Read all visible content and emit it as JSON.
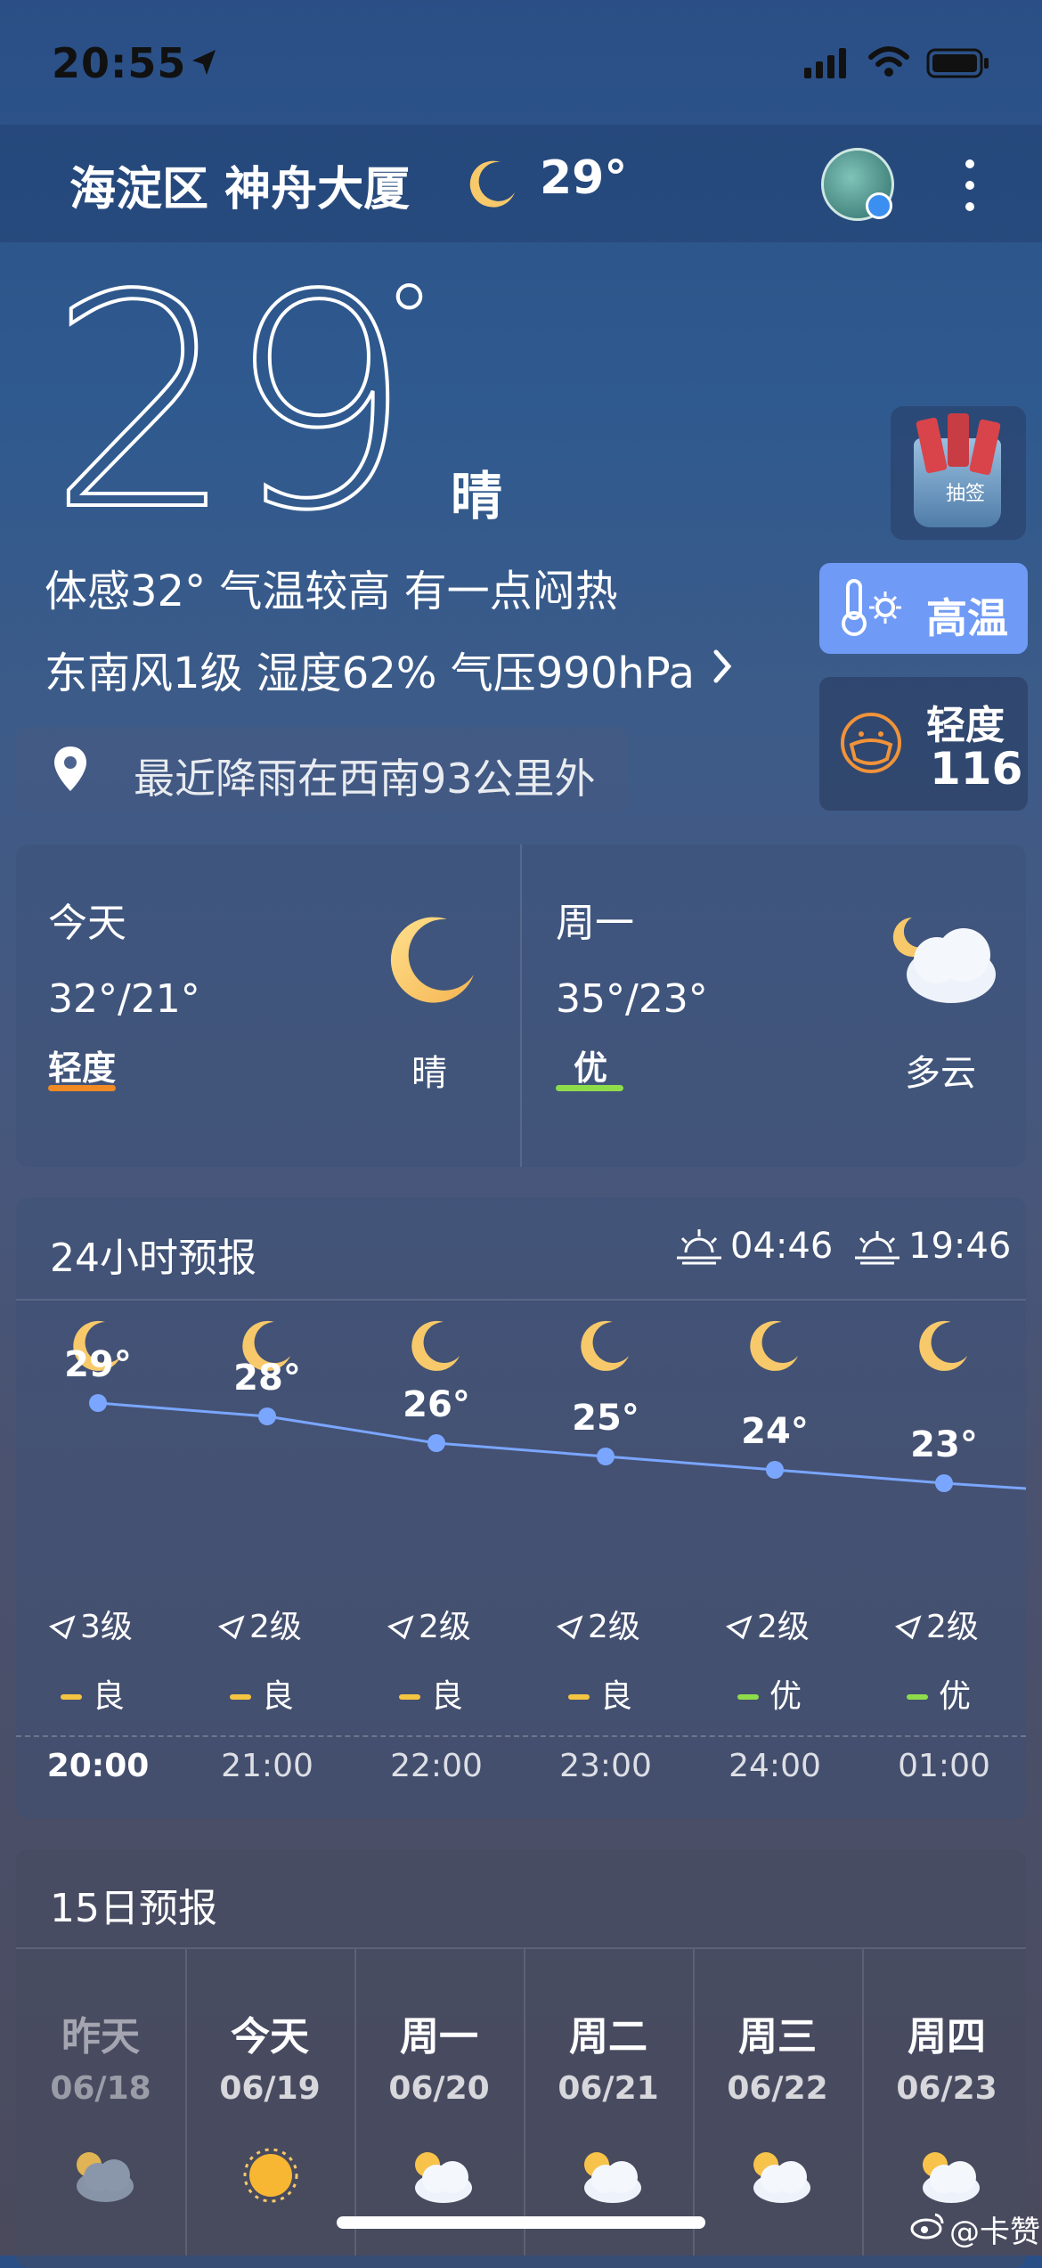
{
  "status_bar": {
    "time": "20:55"
  },
  "header": {
    "location": "海淀区 神舟大厦",
    "temp": "29°"
  },
  "current": {
    "temp": "29",
    "degree": "°",
    "condition": "晴",
    "feels_like": "体感32° 气温较高 有一点闷热",
    "details": "东南风1级 湿度62% 气压990hPa",
    "rain_notice": "最近降雨在西南93公里外"
  },
  "side": {
    "lottery_label": "抽签",
    "alert_label": "高温",
    "aqi_label": "轻度",
    "aqi_value": "116"
  },
  "daily_summary": [
    {
      "day": "今天",
      "range": "32°/21°",
      "aqi": "轻度",
      "aqi_color": "#f08a24",
      "cond": "晴"
    },
    {
      "day": "周一",
      "range": "35°/23°",
      "aqi": "优",
      "aqi_color": "#8fdc4a",
      "cond": "多云"
    }
  ],
  "hourly": {
    "title": "24小时预报",
    "sunrise": "04:46",
    "sunset": "19:46",
    "items": [
      {
        "temp": "29°",
        "wind": "3级",
        "aqi": "良",
        "aqi_color": "#f5c542",
        "time": "20:00"
      },
      {
        "temp": "28°",
        "wind": "2级",
        "aqi": "良",
        "aqi_color": "#f5c542",
        "time": "21:00"
      },
      {
        "temp": "26°",
        "wind": "2级",
        "aqi": "良",
        "aqi_color": "#f5c542",
        "time": "22:00"
      },
      {
        "temp": "25°",
        "wind": "2级",
        "aqi": "良",
        "aqi_color": "#f5c542",
        "time": "23:00"
      },
      {
        "temp": "24°",
        "wind": "2级",
        "aqi": "优",
        "aqi_color": "#8fdc4a",
        "time": "24:00"
      },
      {
        "temp": "23°",
        "wind": "2级",
        "aqi": "优",
        "aqi_color": "#8fdc4a",
        "time": "01:00"
      }
    ]
  },
  "fifteen_day": {
    "title": "15日预报",
    "days": [
      {
        "day": "昨天",
        "date": "06/18",
        "icon": "cloudy-icon"
      },
      {
        "day": "今天",
        "date": "06/19",
        "icon": "sun-icon"
      },
      {
        "day": "周一",
        "date": "06/20",
        "icon": "partly-cloudy-icon"
      },
      {
        "day": "周二",
        "date": "06/21",
        "icon": "partly-cloudy-icon"
      },
      {
        "day": "周三",
        "date": "06/22",
        "icon": "partly-cloudy-icon"
      },
      {
        "day": "周四",
        "date": "06/23",
        "icon": "partly-cloudy-icon"
      }
    ]
  },
  "watermark": "@卡赞",
  "colors": {
    "accent_blue": "#7aa6ff",
    "alert_bg": "#6f9af6",
    "moon": "#f7c96a"
  }
}
